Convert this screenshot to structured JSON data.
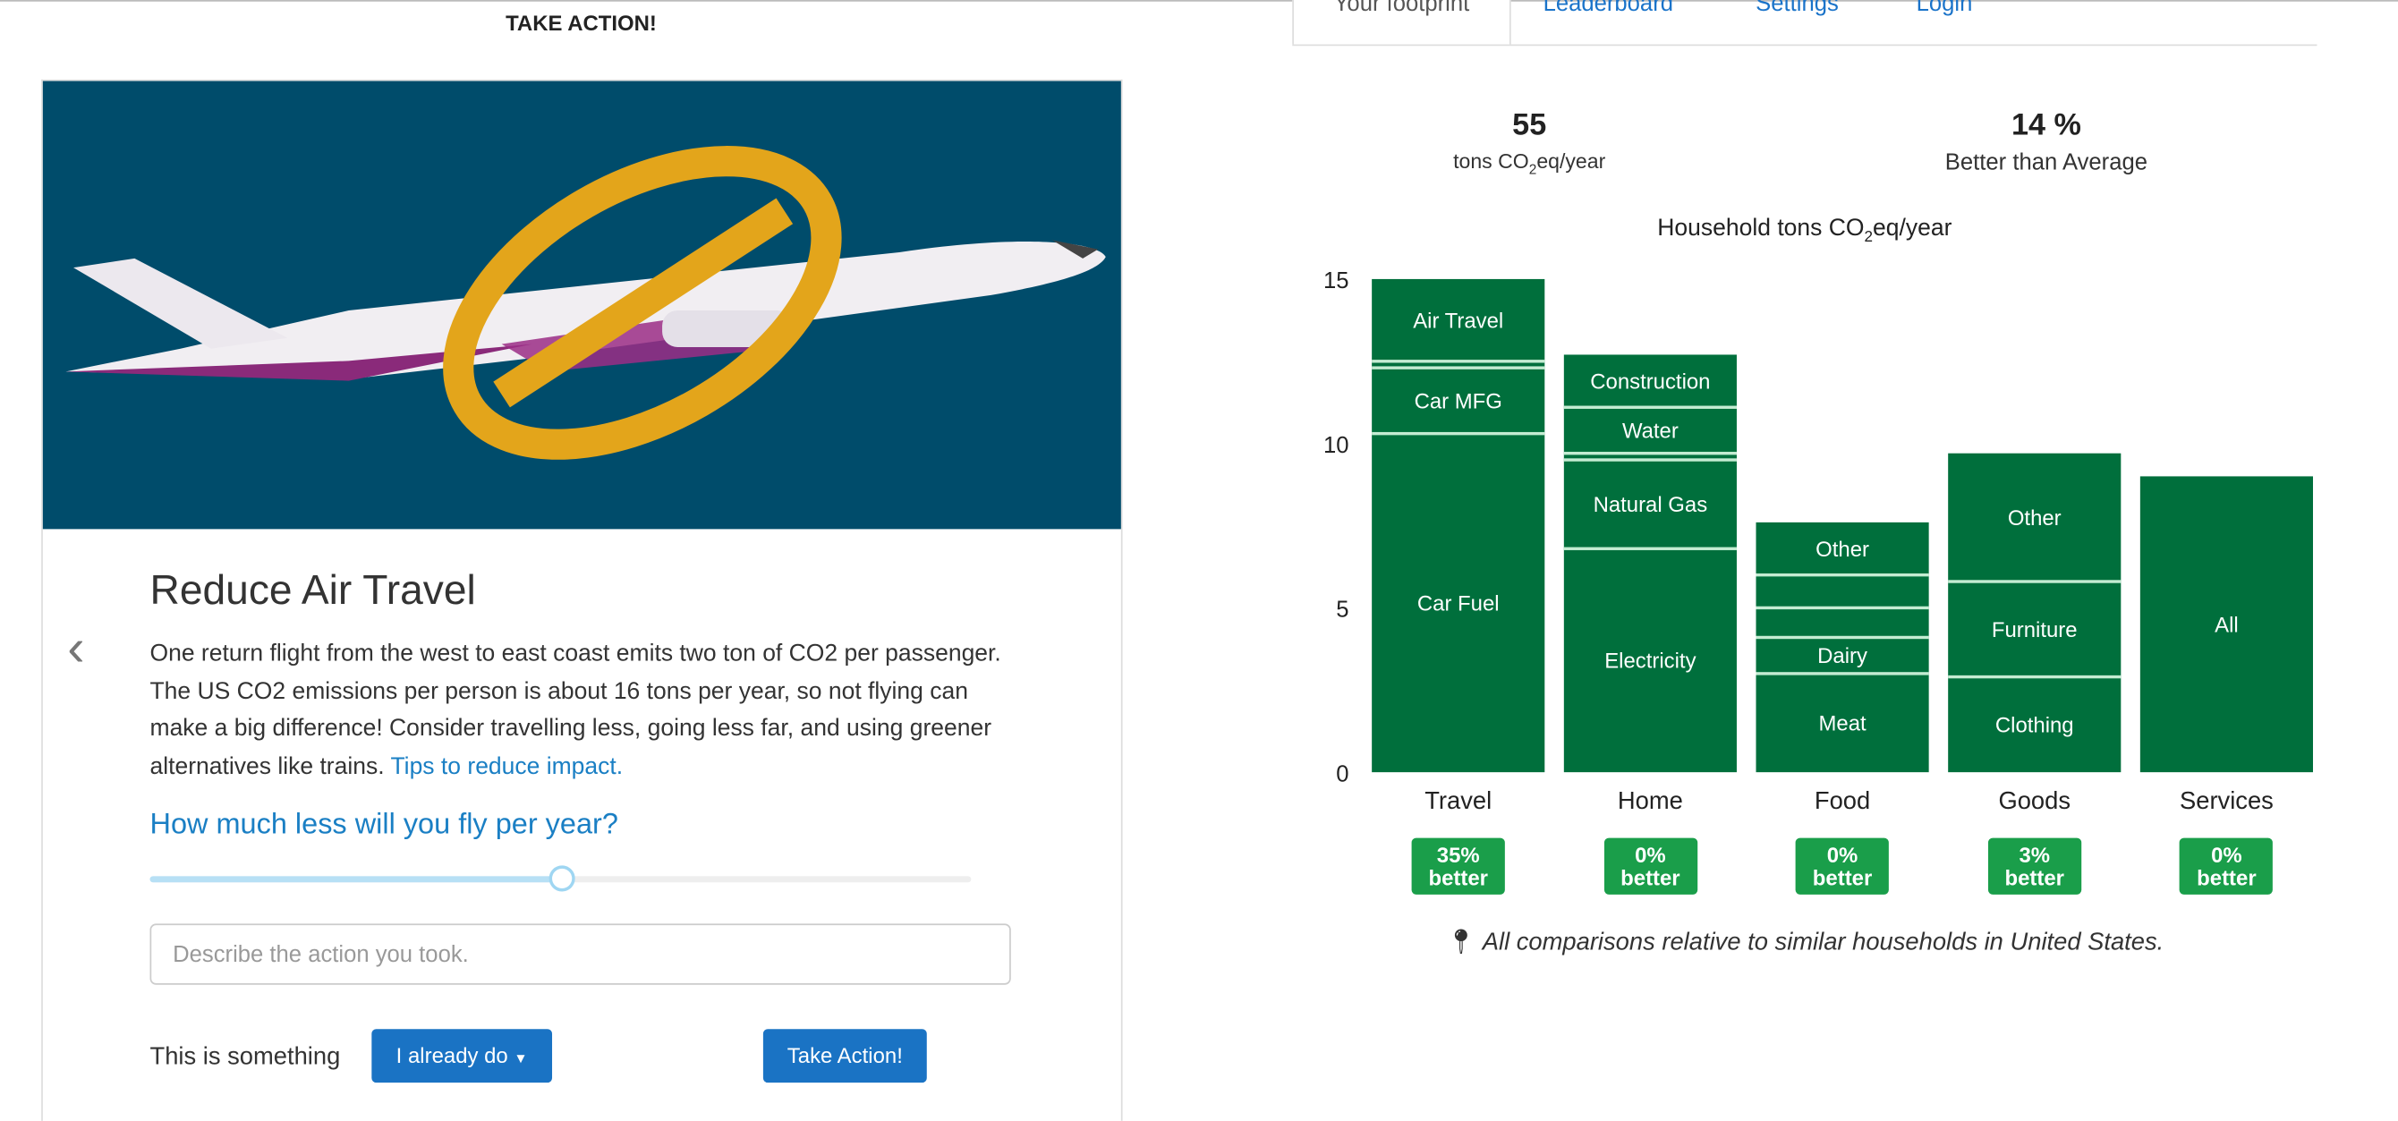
{
  "header": {
    "title": "TAKE ACTION!"
  },
  "tabs": [
    {
      "label": "Your footprint",
      "active": true
    },
    {
      "label": "Leaderboard"
    },
    {
      "label": "Settings"
    },
    {
      "label": "Login"
    }
  ],
  "action_card": {
    "title": "Reduce Air Travel",
    "description": "One return flight from the west to east coast emits two ton of CO2 per passenger. The US CO2 emissions per person is about 16 tons per year, so not flying can make a big difference! Consider travelling less, going less far, and using greener alternatives like trains.",
    "tips_link": "Tips to reduce impact.",
    "question": "How much less will you fly per year?",
    "slider_fraction": 0.5,
    "input_placeholder": "Describe the action you took.",
    "something_label": "This is something",
    "dropdown_value": "I already do",
    "take_action_button": "Take Action!",
    "image_icon": "airplane-prohibited",
    "colors": {
      "hero_bg": "#004c6b",
      "accent": "#1a73c4"
    }
  },
  "stats": {
    "total_value": "55",
    "total_unit_pre": "tons CO",
    "total_unit_sub": "2",
    "total_unit_post": "eq/year",
    "better_value": "14 %",
    "better_label": "Better than Average"
  },
  "chart_data": {
    "type": "bar",
    "stacked": true,
    "title_pre": "Household tons CO",
    "title_sub": "2",
    "title_post": "eq/year",
    "categories": [
      "Travel",
      "Home",
      "Food",
      "Goods",
      "Services"
    ],
    "yticks": [
      "0",
      "5",
      "10",
      "15"
    ],
    "ylim": [
      0,
      15
    ],
    "grid": false,
    "colors": {
      "bar": "#006f3c",
      "divider": "#c4ecd2",
      "badge": "#1a9e4a"
    },
    "stacks": [
      [
        {
          "label": "Car Fuel",
          "value": 10.3
        },
        {
          "label": "Car MFG",
          "value": 2.0
        },
        {
          "label": "",
          "value": 0.2
        },
        {
          "label": "Air Travel",
          "value": 2.5
        }
      ],
      [
        {
          "label": "Electricity",
          "value": 6.8
        },
        {
          "label": "Natural Gas",
          "value": 2.7
        },
        {
          "label": "",
          "value": 0.2
        },
        {
          "label": "Water",
          "value": 1.4
        },
        {
          "label": "Construction",
          "value": 1.6
        }
      ],
      [
        {
          "label": "Meat",
          "value": 3.0
        },
        {
          "label": "Dairy",
          "value": 1.1
        },
        {
          "label": "",
          "value": 0.9
        },
        {
          "label": "",
          "value": 1.0
        },
        {
          "label": "Other",
          "value": 1.6
        }
      ],
      [
        {
          "label": "Clothing",
          "value": 2.9
        },
        {
          "label": "Furniture",
          "value": 2.9
        },
        {
          "label": "Other",
          "value": 3.9
        }
      ],
      [
        {
          "label": "All",
          "value": 9.0
        }
      ]
    ],
    "badges": [
      {
        "pct": "35%",
        "text": "better"
      },
      {
        "pct": "0%",
        "text": "better"
      },
      {
        "pct": "0%",
        "text": "better"
      },
      {
        "pct": "3%",
        "text": "better"
      },
      {
        "pct": "0%",
        "text": "better"
      }
    ]
  },
  "footnote": "All comparisons relative to similar households in United States."
}
